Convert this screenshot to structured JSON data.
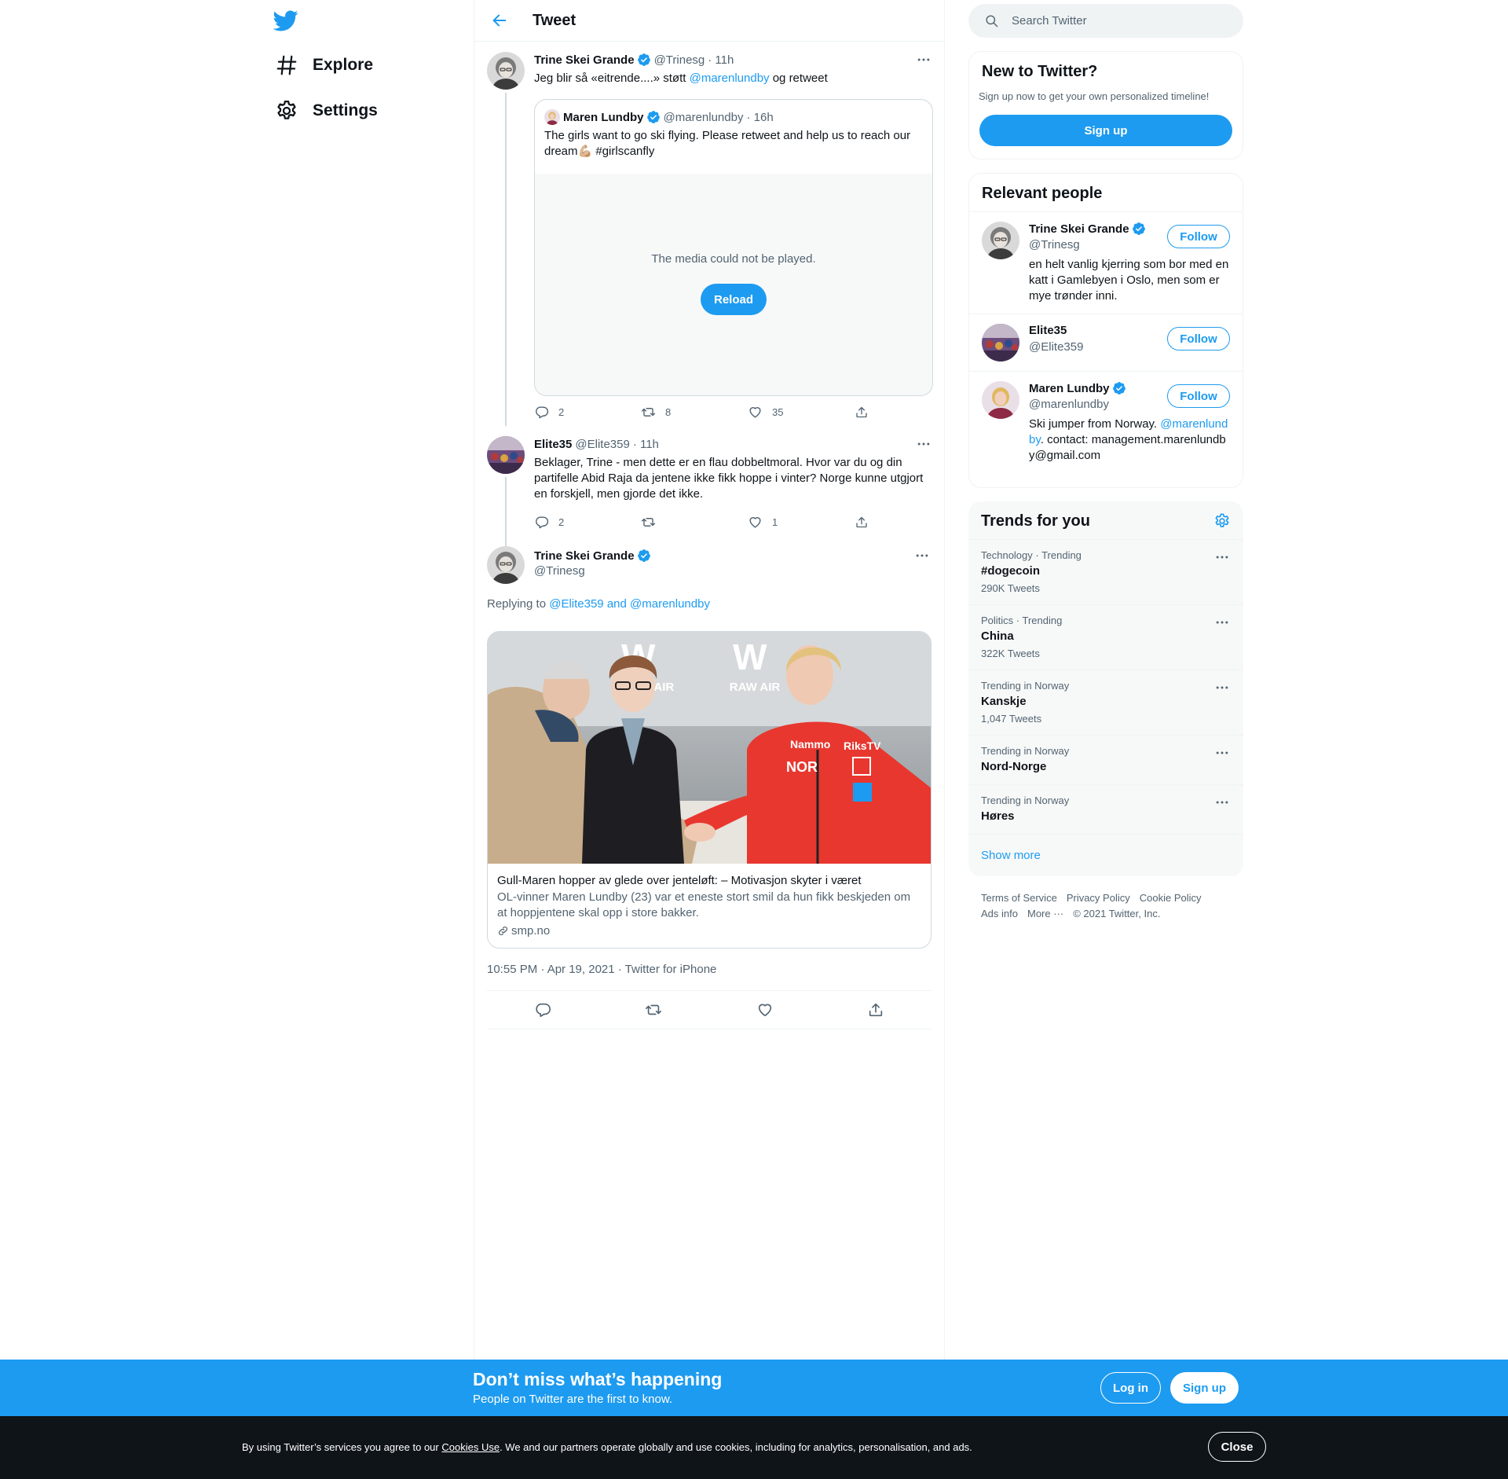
{
  "nav": {
    "explore_label": "Explore",
    "settings_label": "Settings"
  },
  "header": {
    "title": "Tweet"
  },
  "tweet1": {
    "name": "Trine Skei Grande",
    "handle": "@Trinesg",
    "time": "· 11h",
    "text_before": "Jeg blir så «eitrende....» støtt ",
    "mention": "@marenlundby",
    "text_after": "  og retweet",
    "quote": {
      "name": "Maren Lundby",
      "handle": "@marenlundby",
      "time": "· 16h",
      "text": "The girls want to go ski flying. Please retweet and help us to reach our dream💪🏼 #girlscanfly",
      "media_error": "The media could not be played.",
      "reload_label": "Reload"
    },
    "replies": "2",
    "retweets": "8",
    "likes": "35"
  },
  "tweet2": {
    "name": "Elite35",
    "handle": "@Elite359",
    "time": "· 11h",
    "text": "Beklager, Trine - men dette er en flau dobbeltmoral. Hvor var du og din partifelle Abid Raja da jentene ikke fikk hoppe i vinter? Norge kunne utgjort en forskjell, men gjorde det ikke.",
    "replies": "2",
    "retweets": "",
    "likes": "1"
  },
  "main_tweet": {
    "name": "Trine Skei Grande",
    "handle": "@Trinesg",
    "replying_prefix": "Replying to ",
    "replying_to": "@Elite359 and @marenlundby",
    "card": {
      "title": "Gull-Maren hopper av glede over jenteløft: – Motivasjon skyter i været",
      "description": "OL-vinner Maren Lundby (23) var et eneste stort smil da hun fikk beskjeden om at hoppjentene skal opp i store bakker.",
      "source": "smp.no",
      "photo_signs": [
        "RAW AIR",
        "RAW AIR",
        "Nammo",
        "RiksTV",
        "NOR"
      ]
    },
    "meta": "10:55 PM · Apr 19, 2021 · Twitter for iPhone"
  },
  "search": {
    "placeholder": "Search Twitter"
  },
  "new_panel": {
    "title": "New to Twitter?",
    "subtitle": "Sign up now to get your own personalized timeline!",
    "signup_label": "Sign up"
  },
  "people": {
    "title": "Relevant people",
    "follow_label": "Follow",
    "items": [
      {
        "name": "Trine Skei Grande",
        "handle": "@Trinesg",
        "bio": "en helt vanlig kjerring som bor med en katt i Gamlebyen i Oslo, men som er mye trønder inni."
      },
      {
        "name": "Elite35",
        "handle": "@Elite359",
        "bio": ""
      },
      {
        "name": "Maren Lundby",
        "handle": "@marenlundby",
        "bio_before": "Ski jumper from Norway. ",
        "bio_mention": "@marenlundby",
        "bio_after": ". contact: management.marenlundby@gmail.com"
      }
    ]
  },
  "trends": {
    "title": "Trends for you",
    "items": [
      {
        "context": "Technology · Trending",
        "name": "#dogecoin",
        "count": "290K Tweets"
      },
      {
        "context": "Politics · Trending",
        "name": "China",
        "count": "322K Tweets"
      },
      {
        "context": "Trending in Norway",
        "name": "Kanskje",
        "count": "1,047 Tweets"
      },
      {
        "context": "Trending in Norway",
        "name": "Nord-Norge",
        "count": ""
      },
      {
        "context": "Trending in Norway",
        "name": "Høres",
        "count": ""
      }
    ],
    "show_more": "Show more"
  },
  "footer": {
    "terms": "Terms of Service",
    "privacy": "Privacy Policy",
    "cookie": "Cookie Policy",
    "ads": "Ads info",
    "more": "More ···",
    "copyright": "© 2021 Twitter, Inc."
  },
  "bottom_bar": {
    "title": "Don’t miss what’s happening",
    "subtitle": "People on Twitter are the first to know.",
    "login_label": "Log in",
    "signup_label": "Sign up"
  },
  "cookie_bar": {
    "text_before": "By using Twitter’s services you agree to our ",
    "link": "Cookies Use",
    "text_after": ". We and our partners operate globally and use cookies, including for analytics, personalisation, and ads.",
    "close_label": "Close"
  },
  "colors": {
    "accent": "#1d9bf0",
    "text": "#0f1419",
    "muted": "#536471",
    "cookie_bg": "#0f1419"
  }
}
